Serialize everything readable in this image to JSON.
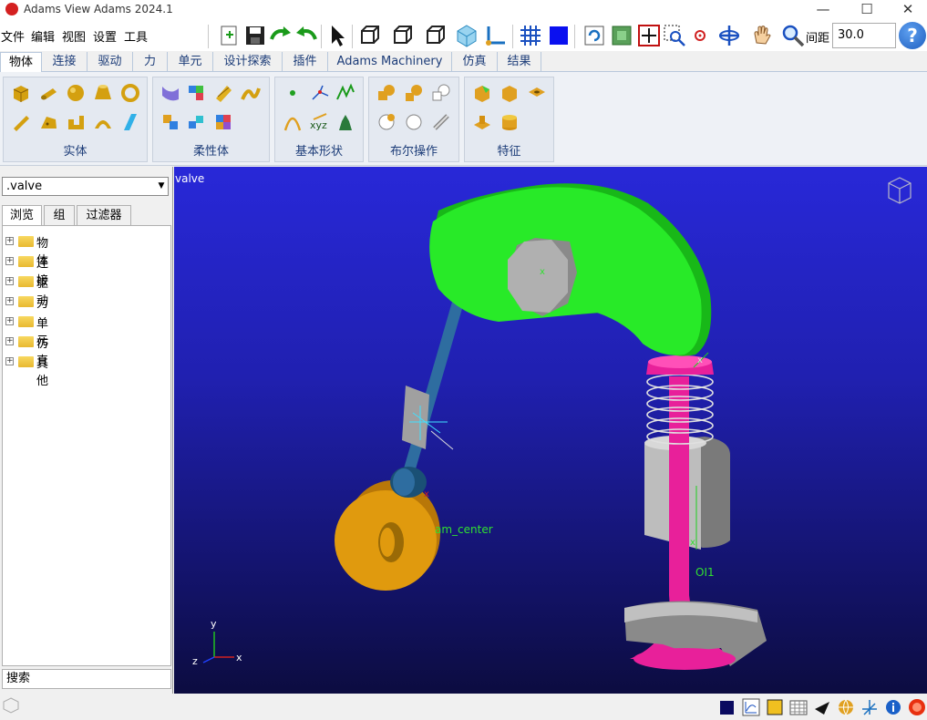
{
  "window": {
    "title": "Adams View Adams 2024.1",
    "minimize": "—",
    "maximize": "☐",
    "close": "✕"
  },
  "menu": [
    "文件",
    "编辑",
    "视图",
    "设置",
    "工具"
  ],
  "toolbar": {
    "spacing_label": "间距",
    "spacing_value": "30.0",
    "help": "?"
  },
  "tabs": [
    "物体",
    "连接",
    "驱动",
    "力",
    "单元",
    "设计探索",
    "插件",
    "Adams Machinery",
    "仿真",
    "结果"
  ],
  "ribbon_groups": [
    "实体",
    "柔性体",
    "基本形状",
    "布尔操作",
    "特征"
  ],
  "left_panel": {
    "model": ".valve",
    "tabs": [
      "浏览",
      "组",
      "过滤器"
    ],
    "tree": [
      "物体",
      "连接",
      "驱动",
      "力",
      "单元",
      "仿真",
      "其他"
    ],
    "search": "搜索"
  },
  "viewport": {
    "model_name": "valve",
    "cam_label": "am_center",
    "marker_label": "OI1",
    "axes": {
      "x": "x",
      "y": "y",
      "z": "z"
    },
    "colors": {
      "rocker": "#20e020",
      "valve": "#e8209a",
      "cam": "#e0960a",
      "pushrod": "#2e6da0",
      "guide": "#b8b8b8"
    }
  }
}
